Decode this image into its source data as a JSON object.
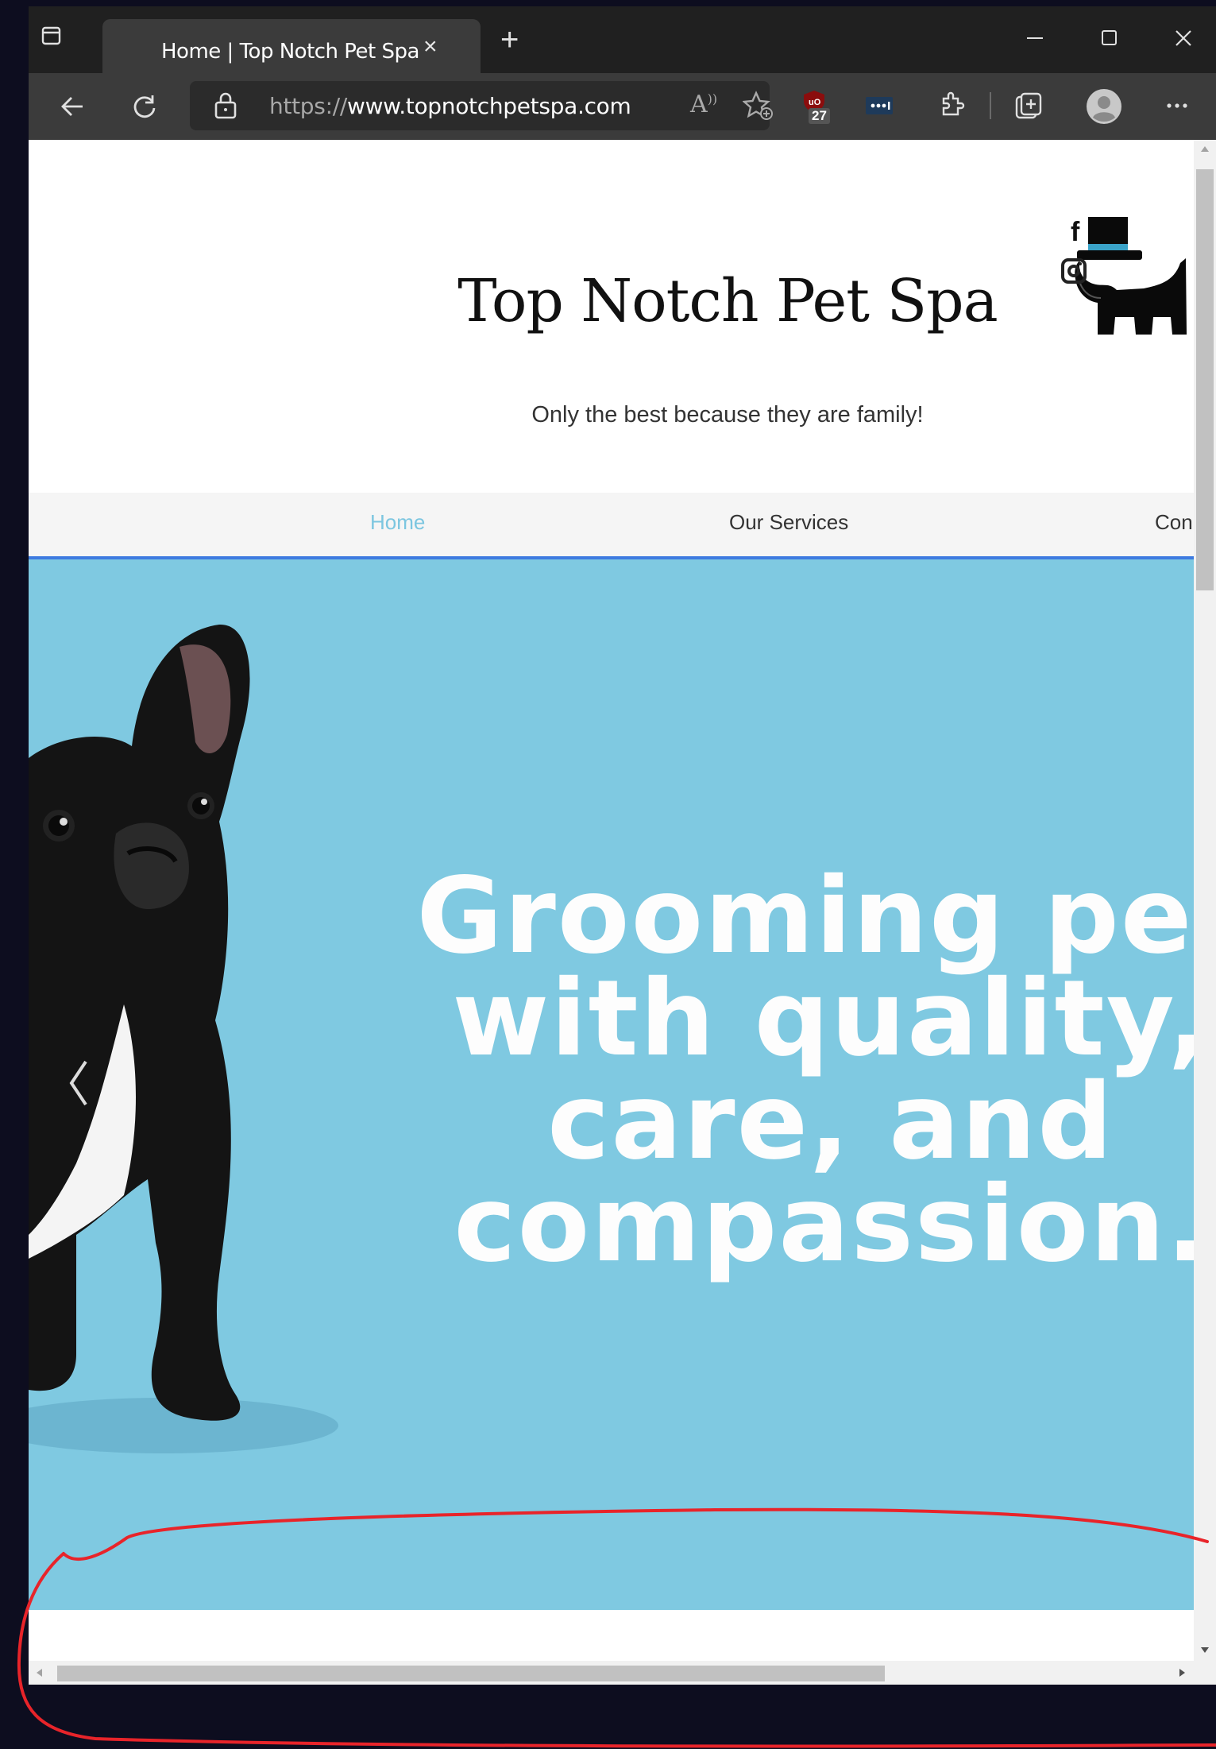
{
  "browser": {
    "tab_title": "Home | Top Notch Pet Spa",
    "tab_close": "×",
    "new_tab": "+",
    "url_prefix": "https://",
    "url_host": "www.topnotchpetspa.com",
    "extension_badge": "27",
    "window_controls": [
      "minimize-icon",
      "maximize-icon",
      "close-icon"
    ]
  },
  "site": {
    "title": "Top Notch Pet Spa",
    "tagline": "Only the best because they are family!",
    "nav": [
      {
        "label": "Home",
        "active": true
      },
      {
        "label": "Our Services",
        "active": false
      },
      {
        "label": "Con",
        "active": false
      }
    ],
    "hero_lines": [
      "Grooming pet",
      "with quality,",
      "care, and",
      "compassion."
    ],
    "colors": {
      "hero_bg": "#7fc9e1",
      "nav_active": "#7cc6e0",
      "nav_underline": "#3d7be0"
    }
  },
  "annotation": {
    "color": "#e8242a"
  }
}
